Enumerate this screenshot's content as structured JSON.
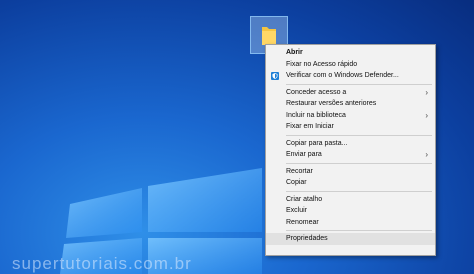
{
  "watermark": "supertutoriais.com.br",
  "menu": {
    "open": "Abrir",
    "pin_quick_access": "Fixar no Acesso rápido",
    "scan_defender": "Verificar com o Windows Defender...",
    "give_access": "Conceder acesso a",
    "restore_versions": "Restaurar versões anteriores",
    "include_library": "Incluir na biblioteca",
    "pin_start": "Fixar em Iniciar",
    "copy_to_folder": "Copiar para pasta...",
    "send_to": "Enviar para",
    "cut": "Recortar",
    "copy": "Copiar",
    "create_shortcut": "Criar atalho",
    "delete": "Excluir",
    "rename": "Renomear",
    "properties": "Propriedades"
  },
  "icons": {
    "folder": "folder-icon",
    "defender": "windows-defender-icon",
    "submenu": "chevron-right-icon"
  },
  "colors": {
    "folder": "#f5c542",
    "defender": "#1e7fd6",
    "menu_bg": "#f2f2f2",
    "highlight": "#e1e1e1"
  }
}
